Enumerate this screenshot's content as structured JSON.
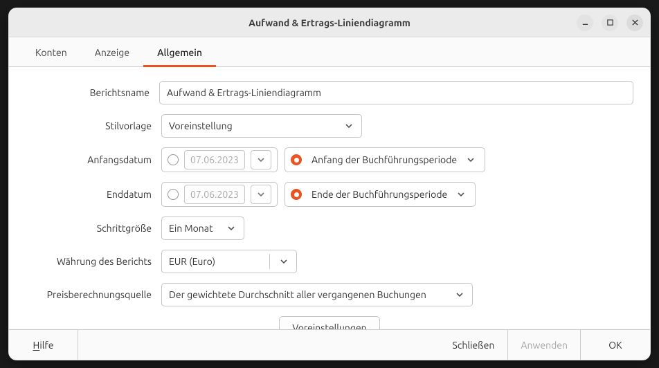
{
  "window": {
    "title": "Aufwand & Ertrags-Liniendiagramm"
  },
  "tabs": {
    "konten": "Konten",
    "anzeige": "Anzeige",
    "allgemein": "Allgemein"
  },
  "labels": {
    "berichtsname": "Berichtsname",
    "stilvorlage": "Stilvorlage",
    "anfangsdatum": "Anfangsdatum",
    "enddatum": "Enddatum",
    "schrittgroesse": "Schrittgröße",
    "waehrung": "Währung des Berichts",
    "preisquelle": "Preisberechnungsquelle"
  },
  "values": {
    "berichtsname": "Aufwand & Ertrags-Liniendiagramm",
    "stilvorlage": "Voreinstellung",
    "anfangsdatum_fix": "07.06.2023",
    "anfangsdatum_rel": "Anfang der Buchführungsperiode",
    "enddatum_fix": "07.06.2023",
    "enddatum_rel": "Ende der Buchführungsperiode",
    "schrittgroesse": "Ein Monat",
    "waehrung": "EUR (Euro)",
    "preisquelle": "Der gewichtete Durchschnitt aller vergangenen Buchungen"
  },
  "buttons": {
    "voreinstellungen": "Voreinstellungen",
    "hilfe_prefix": "H",
    "hilfe_rest": "ilfe",
    "schliessen": "Schließen",
    "anwenden": "Anwenden",
    "ok": "OK"
  }
}
